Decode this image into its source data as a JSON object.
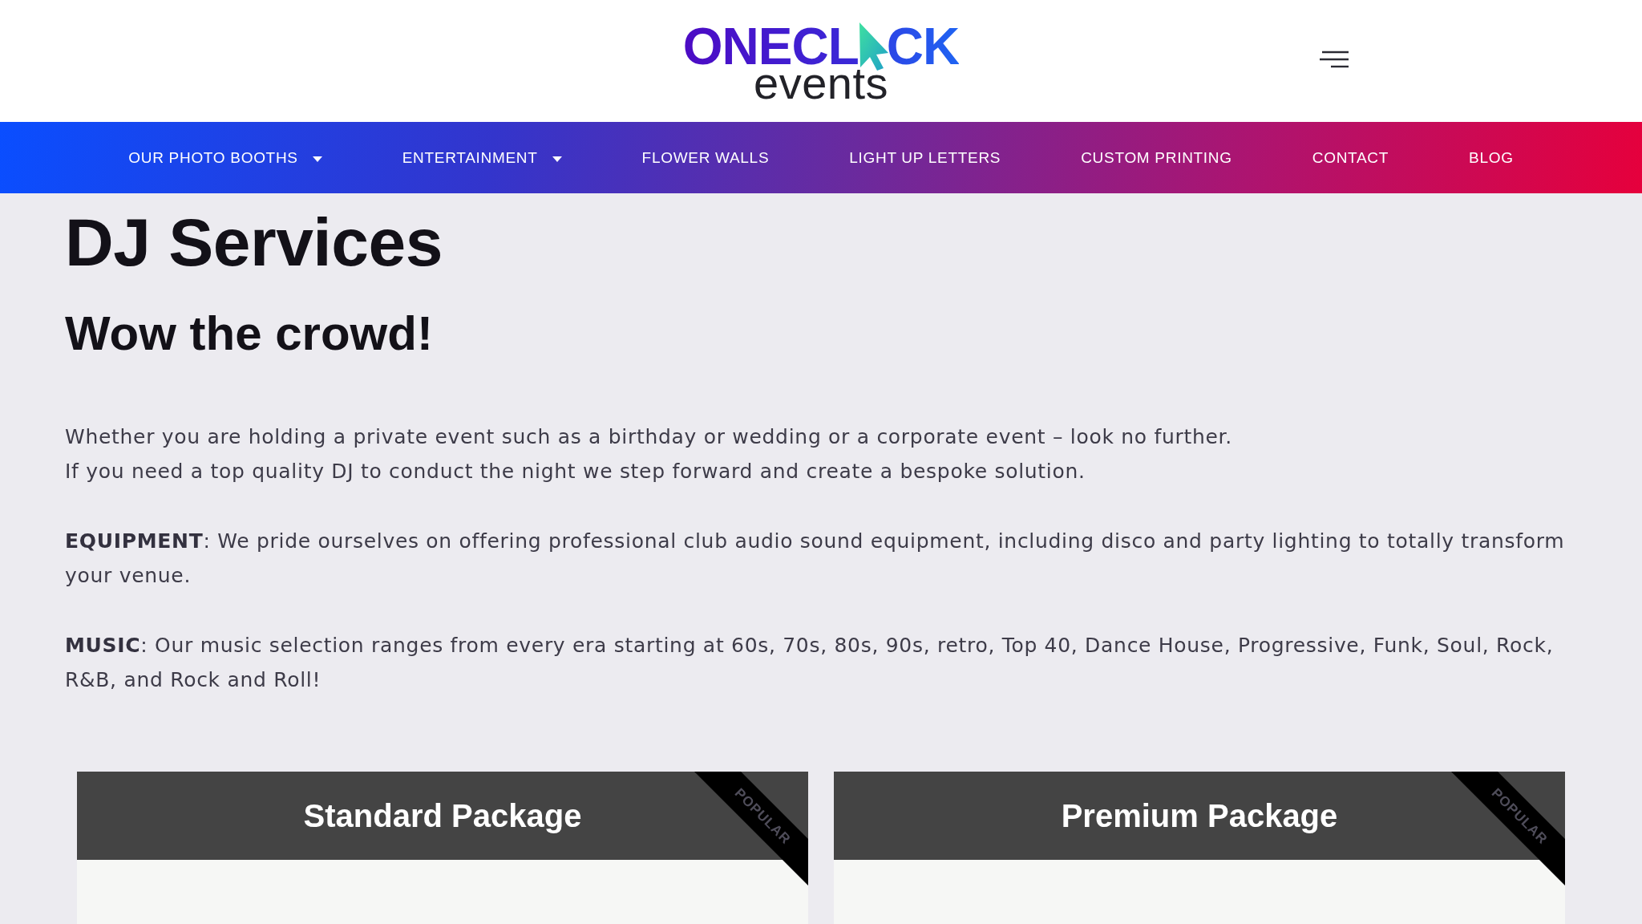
{
  "header": {
    "logo": {
      "wordmark_start": "ONECL",
      "wordmark_end": "CK",
      "tagline": "events"
    }
  },
  "nav": {
    "items": [
      {
        "label": "OUR PHOTO BOOTHS",
        "has_dropdown": true
      },
      {
        "label": "ENTERTAINMENT",
        "has_dropdown": true
      },
      {
        "label": "FLOWER WALLS",
        "has_dropdown": false
      },
      {
        "label": "LIGHT UP LETTERS",
        "has_dropdown": false
      },
      {
        "label": "CUSTOM PRINTING",
        "has_dropdown": false
      },
      {
        "label": "CONTACT",
        "has_dropdown": false
      },
      {
        "label": "BLOG",
        "has_dropdown": false
      }
    ]
  },
  "content": {
    "title": "DJ Services",
    "subtitle": "Wow the crowd!",
    "intro": [
      "Whether you are holding a private event such as a birthday or wedding or a corporate event – look no further.",
      "If you need a top quality DJ to conduct the night we step forward and create a bespoke solution."
    ],
    "paragraphs": [
      "**EQUIPMENT**: We pride ourselves on offering professional club audio sound equipment, including disco and party lighting to totally transform your venue.",
      "**MUSIC**: Our music selection ranges from every era starting at 60s, 70s, 80s, 90s, retro, Top 40, Dance House, Progressive, Funk, Soul, Rock, R&B, and Rock and Roll!"
    ]
  },
  "packages": [
    {
      "title": "Standard Package",
      "ribbon": "POPULAR"
    },
    {
      "title": "Premium Package",
      "ribbon": "POPULAR"
    }
  ]
}
